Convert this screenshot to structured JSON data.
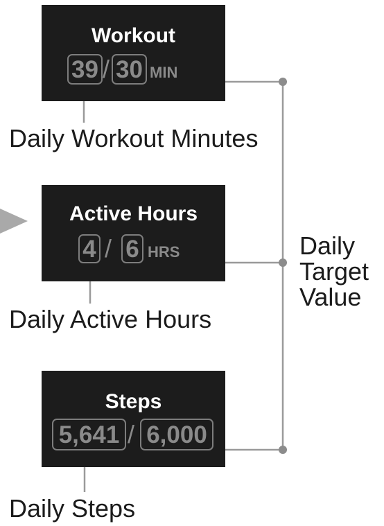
{
  "cards": {
    "workout": {
      "title": "Workout",
      "current": "39",
      "target": "30",
      "unit": "MIN",
      "slash": "/"
    },
    "active": {
      "title": "Active Hours",
      "current": "4",
      "target": "6",
      "unit": "HRS",
      "slash": "/"
    },
    "steps": {
      "title": "Steps",
      "current": "5,641",
      "target": "6,000",
      "slash": "/"
    }
  },
  "labels": {
    "workout": "Daily Workout Minutes",
    "active": "Daily Active Hours",
    "steps": "Daily Steps",
    "target_lines": [
      "Daily",
      "Target",
      "Value"
    ]
  },
  "colors": {
    "card_bg": "#1c1c1c",
    "value_text": "#8a8a8a",
    "connector": "#9a9a9a",
    "pointer": "#a9a9a9"
  }
}
